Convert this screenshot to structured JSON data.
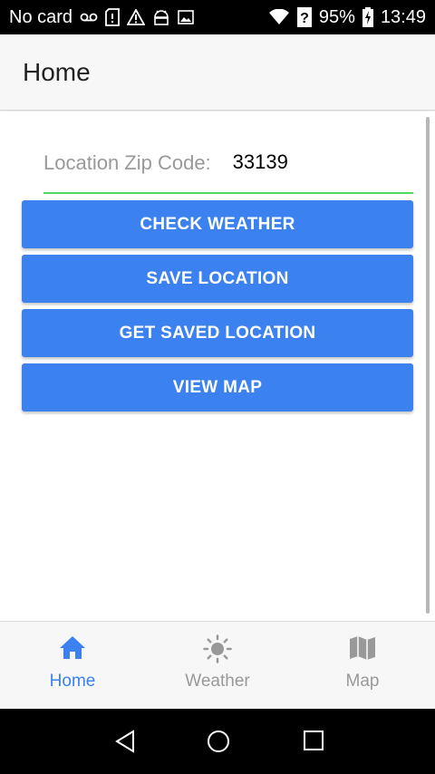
{
  "status_bar": {
    "carrier": "No card",
    "battery": "95%",
    "time": "13:49",
    "icons": [
      "voicemail-icon",
      "sim-alert-icon",
      "warning-icon",
      "android-icon",
      "image-icon",
      "wifi-icon",
      "unknown-signal-icon",
      "battery-charging-icon"
    ]
  },
  "header": {
    "title": "Home"
  },
  "form": {
    "zip_label": "Location Zip Code:",
    "zip_value": "33139",
    "underline_color": "#4cd964"
  },
  "buttons": {
    "check_weather": "CHECK WEATHER",
    "save_location": "SAVE LOCATION",
    "get_saved_location": "GET SAVED LOCATION",
    "view_map": "VIEW MAP"
  },
  "tabs": [
    {
      "label": "Home",
      "icon": "home-icon",
      "active": true
    },
    {
      "label": "Weather",
      "icon": "sun-icon",
      "active": false
    },
    {
      "label": "Map",
      "icon": "map-icon",
      "active": false
    }
  ],
  "nav_bar": {
    "icons": [
      "back-icon",
      "home-circle-icon",
      "recents-icon"
    ]
  },
  "colors": {
    "accent": "#3b82f0",
    "inactive": "#999999",
    "tab_active": "#3b82f0",
    "input_underline": "#4cd964"
  }
}
